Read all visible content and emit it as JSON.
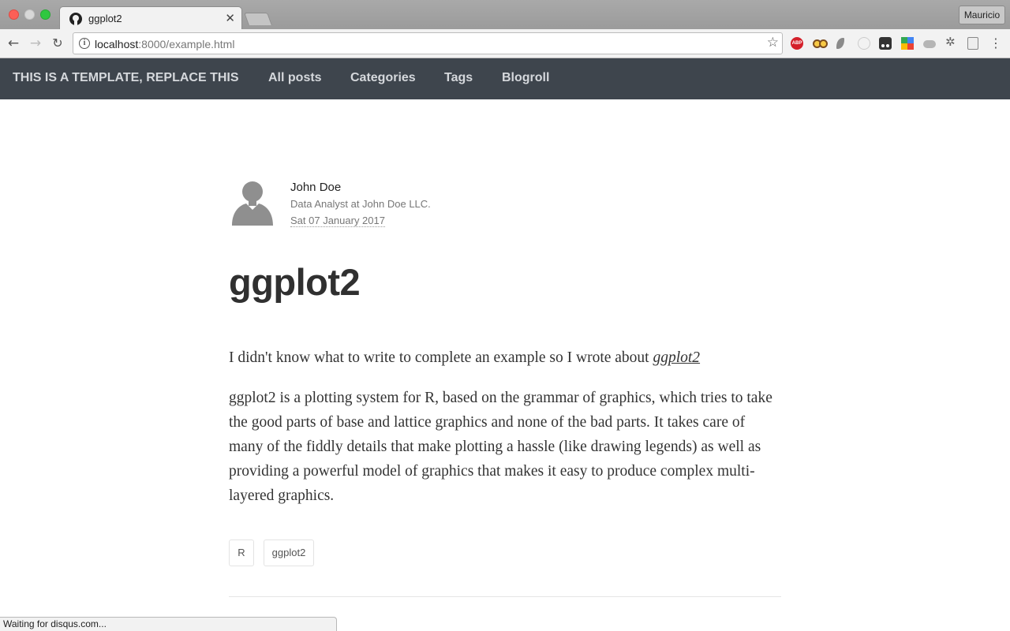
{
  "browser": {
    "tab_title": "ggplot2",
    "url_host": "localhost",
    "url_path": ":8000/example.html",
    "profile_name": "Mauricio",
    "status_text": "Waiting for disqus.com...",
    "extensions": [
      "adblock-plus-icon",
      "owl-icon",
      "feather-icon",
      "circle-icon",
      "tampermonkey-icon",
      "color-picker-icon",
      "cloud-icon",
      "bug-icon",
      "document-icon"
    ]
  },
  "site_nav": {
    "brand": "THIS IS A TEMPLATE, REPLACE THIS",
    "items": [
      "All posts",
      "Categories",
      "Tags",
      "Blogroll"
    ]
  },
  "author": {
    "name": "John Doe",
    "role": "Data Analyst at John Doe LLC.",
    "date": "Sat 07 January 2017"
  },
  "post": {
    "title": "ggplot2",
    "intro_text": "I didn't know what to write to complete an example so I wrote about ",
    "intro_link": "ggplot2",
    "body": "ggplot2 is a plotting system for R, based on the grammar of graphics, which tries to take the good parts of base and lattice graphics and none of the bad parts. It takes care of many of the fiddly details that make plotting a hassle (like drawing legends) as well as providing a powerful model of graphics that makes it easy to produce complex multi-layered graphics.",
    "tags": [
      "R",
      "ggplot2"
    ]
  },
  "colors": {
    "navbar_bg": "#3e454d",
    "navbar_text": "#d5d8dc",
    "title_text": "#303030"
  }
}
